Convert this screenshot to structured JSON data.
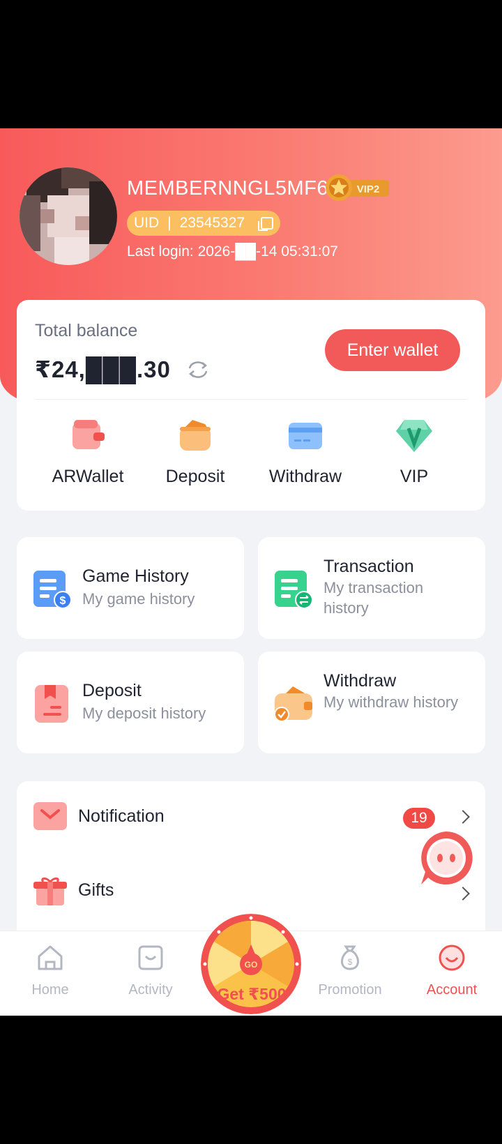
{
  "profile": {
    "username": "MEMBERNNGL5MF6",
    "vip_label": "VIP2",
    "uid_label": "UID",
    "uid_sep": "|",
    "uid_value": "23545327",
    "last_login": "Last login: 2026-██-14 05:31:07"
  },
  "balance": {
    "label": "Total balance",
    "value": "₹24,███.30",
    "wallet_button": "Enter wallet"
  },
  "quick_actions": [
    {
      "label": "ARWallet",
      "icon": "wallet-icon"
    },
    {
      "label": "Deposit",
      "icon": "deposit-icon"
    },
    {
      "label": "Withdraw",
      "icon": "card-icon"
    },
    {
      "label": "VIP",
      "icon": "vip-gem-icon"
    }
  ],
  "history_cards": [
    {
      "title": "Game History",
      "subtitle": "My game history",
      "icon": "game-history-icon"
    },
    {
      "title": "Transaction",
      "subtitle": "My transaction history",
      "icon": "transaction-icon"
    },
    {
      "title": "Deposit",
      "subtitle": "My deposit history",
      "icon": "deposit-history-icon"
    },
    {
      "title": "Withdraw",
      "subtitle": "My withdraw history",
      "icon": "withdraw-history-icon"
    }
  ],
  "list": [
    {
      "label": "Notification",
      "badge": "19",
      "icon": "mail-icon"
    },
    {
      "label": "Gifts",
      "icon": "gift-icon"
    }
  ],
  "nav": {
    "home": "Home",
    "activity": "Activity",
    "center": "Get ₹500",
    "center_go": "GO",
    "promotion": "Promotion",
    "account": "Account"
  },
  "colors": {
    "accent": "#f25a5a",
    "header_start": "#f85a5a",
    "header_end": "#fc9b8e",
    "uid_pill": "#fbbf61",
    "nav_inactive": "#b3b7c2"
  }
}
